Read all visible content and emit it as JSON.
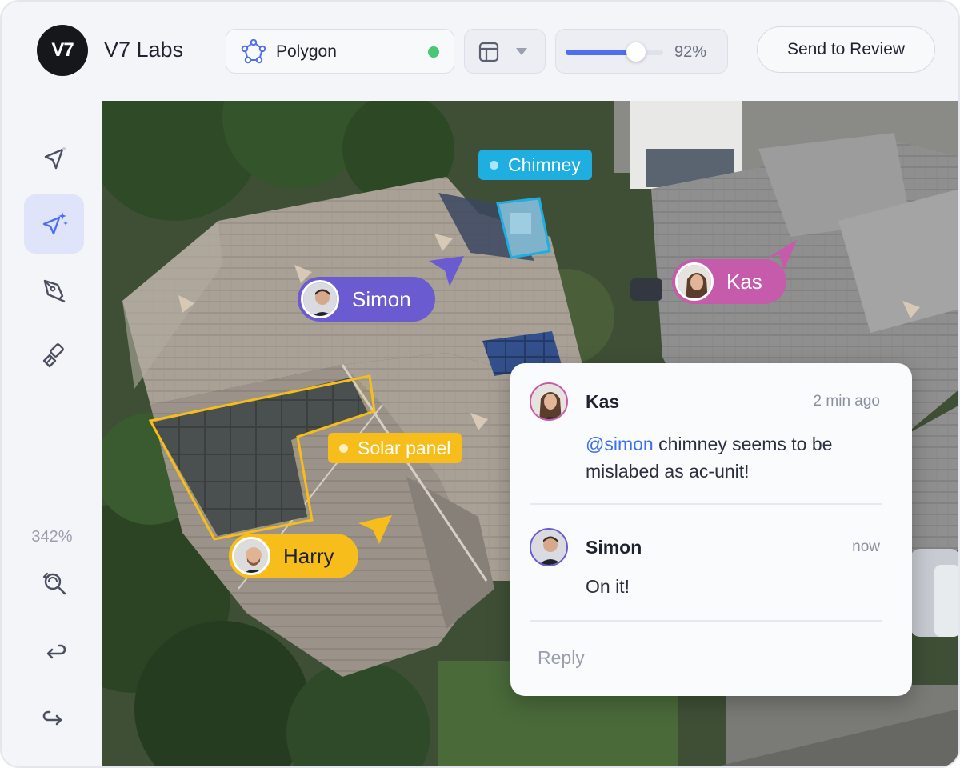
{
  "app": {
    "logo_text": "V7",
    "name": "V7 Labs"
  },
  "toolbar": {
    "tool_name": "Polygon",
    "tool_icon": "polygon-icon",
    "status_color": "#48c774",
    "layout_icon": "layout-icon",
    "slider_percent": 92,
    "slider_label": "92%",
    "review_label": "Send to Review"
  },
  "sidebar": {
    "tools": [
      "cursor-icon",
      "ai-cursor-icon",
      "pen-icon",
      "brush-icon"
    ],
    "active_tool": "ai-cursor-icon",
    "zoom_label": "342%",
    "actions": [
      "zoom-fit-icon",
      "undo-icon",
      "redo-icon"
    ]
  },
  "canvas": {
    "collaborators": [
      {
        "name": "Simon",
        "color": "#6a5bd1"
      },
      {
        "name": "Kas",
        "color": "#c65aab"
      },
      {
        "name": "Harry",
        "color": "#f7bd1a"
      }
    ],
    "labels": [
      {
        "text": "Chimney",
        "color": "#1eaee0"
      },
      {
        "text": "Solar panel",
        "color": "#f7bd1a"
      }
    ]
  },
  "comments": {
    "thread": [
      {
        "author": "Kas",
        "time": "2 min ago",
        "mention": "@simon",
        "text": " chimney seems to be mislabed as ac-unit!"
      },
      {
        "author": "Simon",
        "time": "now",
        "text": "On it!"
      }
    ],
    "reply_placeholder": "Reply"
  }
}
